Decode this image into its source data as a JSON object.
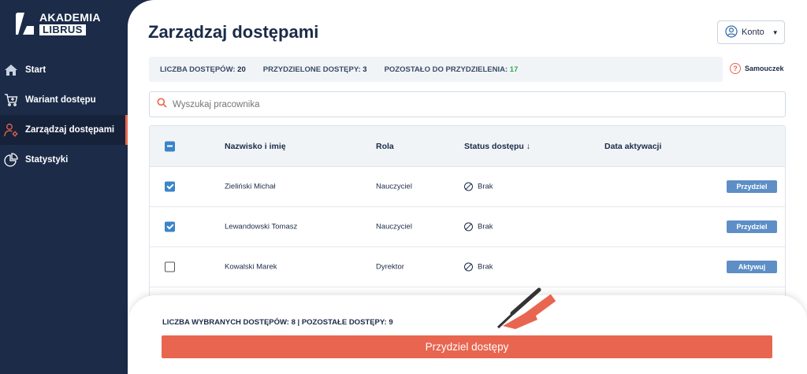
{
  "brand": {
    "line1": "AKADEMIA",
    "line2": "LIBRUS"
  },
  "sidebar": {
    "items": [
      {
        "label": "Start",
        "icon": "home-icon",
        "active": false
      },
      {
        "label": "Wariant dostępu",
        "icon": "cart-icon",
        "active": false
      },
      {
        "label": "Zarządzaj dostępami",
        "icon": "users-gear-icon",
        "active": true
      },
      {
        "label": "Statystyki",
        "icon": "pie-chart-icon",
        "active": false
      }
    ]
  },
  "header": {
    "title": "Zarządzaj dostępami",
    "account_label": "Konto"
  },
  "stats": {
    "total_label": "LICZBA DOSTĘPÓW:",
    "total_value": "20",
    "assigned_label": "PRZYDZIELONE DOSTĘPY:",
    "assigned_value": "3",
    "remaining_label": "POZOSTAŁO DO PRZYDZIELENIA:",
    "remaining_value": "17",
    "remaining_color": "#3aa64a"
  },
  "tutorial_label": "Samouczek",
  "search": {
    "placeholder": "Wyszukaj pracownika"
  },
  "table": {
    "headers": {
      "name": "Nazwisko i imię",
      "role": "Rola",
      "status": "Status dostępu ↓",
      "date": "Data aktywacji"
    },
    "rows": [
      {
        "name": "Zieliński Michał",
        "role": "Nauczyciel",
        "status": "Brak",
        "date": "",
        "checked": true,
        "action": "Przydziel"
      },
      {
        "name": "Lewandowski Tomasz",
        "role": "Nauczyciel",
        "status": "Brak",
        "date": "",
        "checked": true,
        "action": "Przydziel"
      },
      {
        "name": "Kowalski Marek",
        "role": "Dyrektor",
        "status": "Brak",
        "date": "",
        "checked": false,
        "action": "Aktywuj"
      }
    ]
  },
  "footer": {
    "selected_info": "LICZBA WYBRANYCH DOSTĘPÓW: 8 | POZOSTAŁE DOSTĘPY: 9",
    "assign_button": "Przydziel dostępy"
  },
  "colors": {
    "sidebar_bg": "#1b2b48",
    "accent": "#e8654f",
    "action_button": "#5d8ec6",
    "checkbox": "#3b84c8"
  }
}
